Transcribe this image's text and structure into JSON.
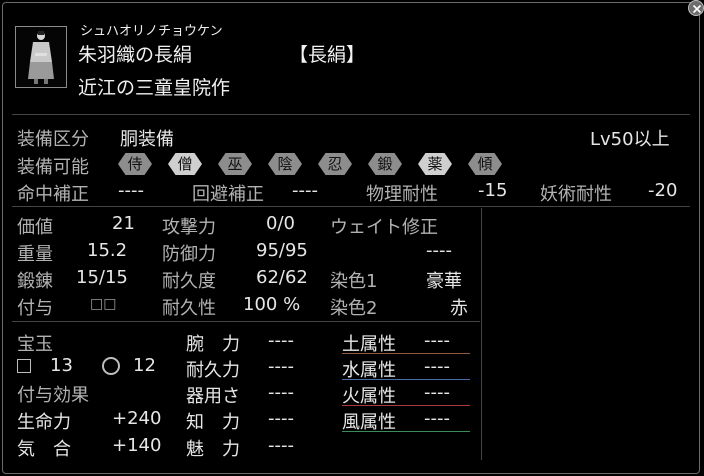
{
  "item": {
    "reading": "シュハオリノチョウケン",
    "name": "朱羽織の長絹",
    "type_bracket": "【長絹】",
    "maker": "近江の三童皇院作"
  },
  "equip": {
    "slot_label": "装備区分",
    "slot_value": "胴装備",
    "level_req": "Lv50以上",
    "jobs_label": "装備可能",
    "jobs": [
      {
        "label": "侍",
        "active": false
      },
      {
        "label": "僧",
        "active": true
      },
      {
        "label": "巫",
        "active": false
      },
      {
        "label": "陰",
        "active": false
      },
      {
        "label": "忍",
        "active": false
      },
      {
        "label": "鍛",
        "active": false
      },
      {
        "label": "薬",
        "active": true
      },
      {
        "label": "傾",
        "active": false
      }
    ]
  },
  "mods": {
    "hit_label": "命中補正",
    "hit_value": "----",
    "evade_label": "回避補正",
    "evade_value": "----",
    "phys_label": "物理耐性",
    "phys_value": "-15",
    "mag_label": "妖術耐性",
    "mag_value": "-20"
  },
  "stats": {
    "price_label": "価値",
    "price_value": "21",
    "weight_label": "重量",
    "weight_value": "15.2",
    "forge_label": "鍛錬",
    "forge_value": "15/15",
    "grant_label": "付与",
    "grant_value": "□□",
    "atk_label": "攻撃力",
    "atk_value": "0/0",
    "def_label": "防御力",
    "def_value": "95/95",
    "dur_label": "耐久度",
    "dur_value": "62/62",
    "durp_label": "耐久性",
    "durp_value": "100 %",
    "wmod_label": "ウェイト修正",
    "wmod_value": "----",
    "dye1_label": "染色1",
    "dye1_value": "豪華",
    "dye2_label": "染色2",
    "dye2_value": "赤"
  },
  "gems": {
    "label": "宝玉",
    "square_count": "13",
    "circle_count": "12",
    "effects_label": "付与効果",
    "effects": [
      {
        "label": "生命力",
        "value": "+240"
      },
      {
        "label": "気　合",
        "value": "+140"
      }
    ]
  },
  "attrs": [
    {
      "label": "腕　力",
      "value": "----"
    },
    {
      "label": "耐久力",
      "value": "----"
    },
    {
      "label": "器用さ",
      "value": "----"
    },
    {
      "label": "知　力",
      "value": "----"
    },
    {
      "label": "魅　力",
      "value": "----"
    }
  ],
  "elements": [
    {
      "label": "土属性",
      "value": "----",
      "color": "#8a5a3a"
    },
    {
      "label": "水属性",
      "value": "----",
      "color": "#4a6fa8"
    },
    {
      "label": "火属性",
      "value": "----",
      "color": "#a83a3a"
    },
    {
      "label": "風属性",
      "value": "----",
      "color": "#3a8a5a"
    }
  ],
  "colors": {
    "job_active": "#cfcfcf",
    "job_inactive": "#8d8d8d"
  },
  "icons": {
    "close": "close-icon",
    "item_thumbnail": "kimono-figure-icon",
    "gem_square": "square-slot-icon",
    "gem_circle": "circle-slot-icon"
  }
}
